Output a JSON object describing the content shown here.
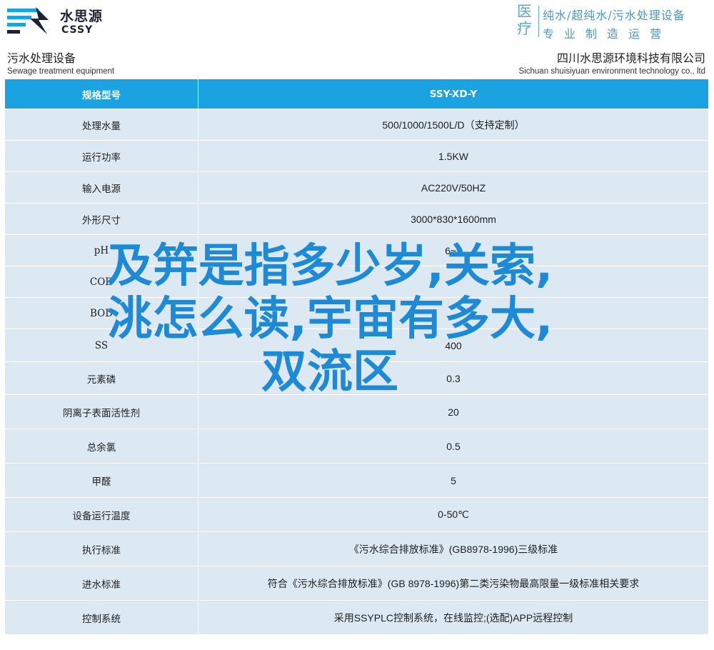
{
  "header": {
    "brand_cn": "水思源",
    "brand_en": "CSSY",
    "slogan_side": [
      "医",
      "疗"
    ],
    "slogan_line1": "纯水/超纯水/污水处理设备",
    "slogan_line2": "专业制造运营",
    "accent_color": "#1aa3e0"
  },
  "title": {
    "left_cn": "污水处理设备",
    "left_en": "Sewage treatment equipment",
    "right_cn": "四川水思源环境科技有限公司",
    "right_en": "Sichuan shuisiyuan environment technology co., ltd"
  },
  "table": {
    "head": {
      "label": "规格型号",
      "value": "SSY-XD-Y"
    },
    "rows": [
      {
        "label": "处理水量",
        "value": "500/1000/1500L/D（支持定制）"
      },
      {
        "label": "运行功率",
        "value": "1.5KW"
      },
      {
        "label": "输入电源",
        "value": "AC220V/50HZ"
      },
      {
        "label": "外形尺寸",
        "value": "3000*830*1600mm"
      },
      {
        "label": "pH",
        "value": "6~9"
      },
      {
        "label": "COD",
        "value": ""
      },
      {
        "label": "BOD",
        "value": ""
      },
      {
        "label": "SS",
        "value": "400"
      },
      {
        "label": "元素磷",
        "value": "0.3"
      },
      {
        "label": "阴离子表面活性剂",
        "value": "20"
      },
      {
        "label": "总余氯",
        "value": "0.5"
      },
      {
        "label": "甲醛",
        "value": "5"
      },
      {
        "label": "设备运行温度",
        "value": "0-50℃"
      },
      {
        "label": "执行标准",
        "value": "《污水综合排放标准》(GB8978-1996)三级标准"
      },
      {
        "label": "进水标准",
        "value": "符合《污水综合排放标准》(GB 8978-1996)第二类污染物最高限量一级标准相关要求"
      },
      {
        "label": "控制系统",
        "value": "采用SSYPLC控制系统，在线监控;(选配)APP远程控制"
      }
    ]
  },
  "overlay": {
    "lines": [
      "及笄是指多少岁,关索,",
      "洮怎么读,宇宙有多大,",
      "双流区"
    ]
  }
}
